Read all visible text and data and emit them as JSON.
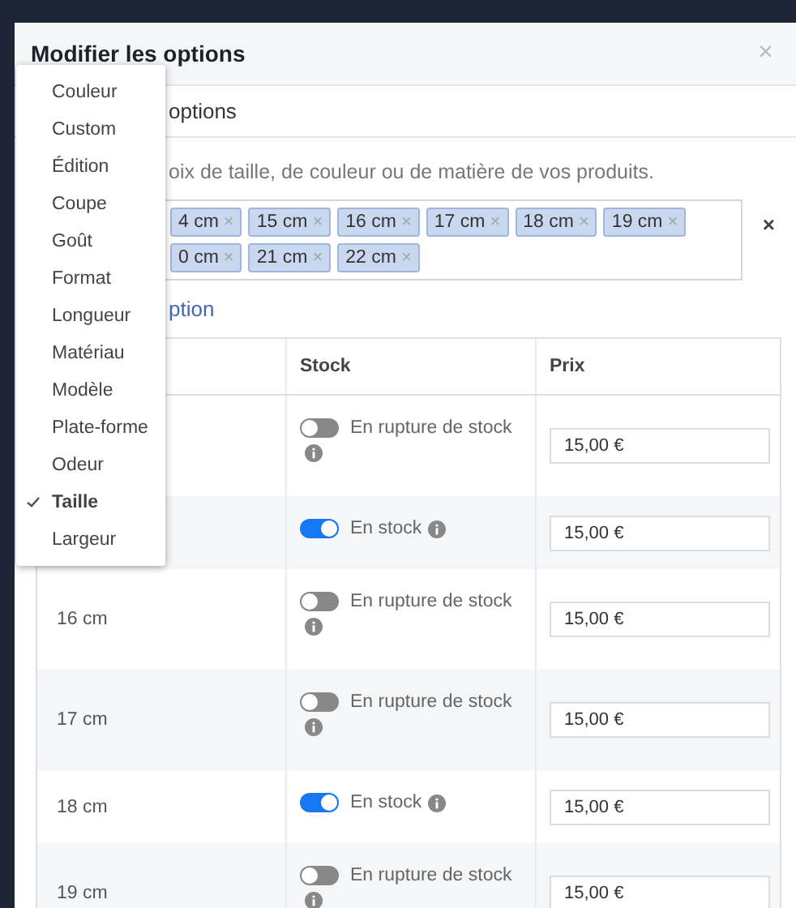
{
  "dialog": {
    "title": "Modifier les options",
    "close": "×"
  },
  "tab": {
    "label": "options"
  },
  "description": "oix de taille, de couleur ou de matière de vos produits.",
  "tags": {
    "items": [
      {
        "label": "4 cm",
        "remove": "×"
      },
      {
        "label": "15 cm",
        "remove": "×"
      },
      {
        "label": "16 cm",
        "remove": "×"
      },
      {
        "label": "17 cm",
        "remove": "×"
      },
      {
        "label": "18 cm",
        "remove": "×"
      },
      {
        "label": "19 cm",
        "remove": "×"
      },
      {
        "label": "0 cm",
        "remove": "×"
      },
      {
        "label": "21 cm",
        "remove": "×"
      },
      {
        "label": "22 cm",
        "remove": "×"
      }
    ],
    "clear": "×"
  },
  "add_link": "ption",
  "table": {
    "columns": [
      "Stock",
      "Prix"
    ],
    "rows": [
      {
        "in_stock": false,
        "stock": "En rupture de stock",
        "price": "15,00 €"
      },
      {
        "in_stock": true,
        "stock": "En stock",
        "price": "15,00 €"
      },
      {
        "label": "16 cm",
        "in_stock": false,
        "stock": "En rupture de stock",
        "price": "15,00 €"
      },
      {
        "label": "17 cm",
        "in_stock": false,
        "stock": "En rupture de stock",
        "price": "15,00 €"
      },
      {
        "label": "18 cm",
        "in_stock": true,
        "stock": "En stock",
        "price": "15,00 €"
      },
      {
        "label": "19 cm",
        "in_stock": false,
        "stock": "En rupture de stock",
        "price": "15,00 €"
      }
    ]
  },
  "menu": {
    "items": [
      {
        "label": "Couleur",
        "selected": false
      },
      {
        "label": "Custom",
        "selected": false
      },
      {
        "label": "Édition",
        "selected": false
      },
      {
        "label": "Coupe",
        "selected": false
      },
      {
        "label": "Goût",
        "selected": false
      },
      {
        "label": "Format",
        "selected": false
      },
      {
        "label": "Longueur",
        "selected": false
      },
      {
        "label": "Matériau",
        "selected": false
      },
      {
        "label": "Modèle",
        "selected": false
      },
      {
        "label": "Plate-forme",
        "selected": false
      },
      {
        "label": "Odeur",
        "selected": false
      },
      {
        "label": "Taille",
        "selected": true
      },
      {
        "label": "Largeur",
        "selected": false
      }
    ]
  }
}
